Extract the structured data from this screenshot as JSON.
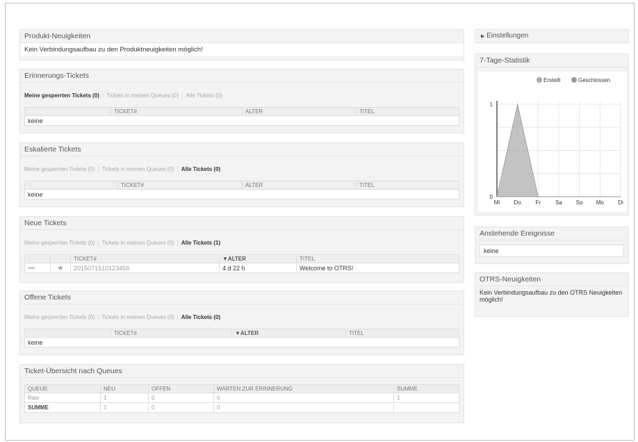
{
  "produkt_neuigkeiten": {
    "title": "Produkt-Neuigkeiten",
    "message": "Kein Verbindungsaufbau zu den Produktneuigkeiten möglich!"
  },
  "filters": {
    "locked": "Meine gesperrten Tickets",
    "queues": "Tickets in meinen Queues",
    "all": "Alle Tickets"
  },
  "columns": {
    "ticket": "TICKET#",
    "alter": "ALTER",
    "alter_sorted": "▼ALTER",
    "titel": "TITEL"
  },
  "erinnerung": {
    "title": "Erinnerungs-Tickets",
    "locked_count": "(0)",
    "queues_count": "(0)",
    "all_count": "(0)",
    "empty": "keine"
  },
  "eskaliert": {
    "title": "Eskalierte Tickets",
    "locked_count": "(0)",
    "queues_count": "(0)",
    "all_count": "(0)",
    "empty": "keine"
  },
  "neue": {
    "title": "Neue Tickets",
    "locked_count": "(0)",
    "queues_count": "(0)",
    "all_count": "(1)",
    "row": {
      "number": "2015071510123456",
      "age": "4 d 22 h",
      "title": "Welcome to OTRS!"
    }
  },
  "offene": {
    "title": "Offene Tickets",
    "locked_count": "(0)",
    "queues_count": "(0)",
    "all_count": "(0)",
    "empty": "keine"
  },
  "queues_overview": {
    "title": "Ticket-Übersicht nach Queues",
    "headers": [
      "QUEUE",
      "NEU",
      "OFFEN",
      "WARTEN ZUR ERINNERUNG",
      "SUMME"
    ],
    "rows": [
      [
        "Raw",
        "1",
        "0",
        "0",
        "1"
      ],
      [
        "SUMME",
        "1",
        "0",
        "0",
        ""
      ]
    ]
  },
  "sidebar": {
    "settings": "Einstellungen",
    "stats_title": "7-Tage-Statistik",
    "legend": [
      "Erstellt",
      "Geschlossen"
    ],
    "pending_title": "Anstehende Ereignisse",
    "pending_value": "keine",
    "otrs_title": "OTRS-Neuigkeiten",
    "otrs_message": "Kein Verbindungsaufbau zu den OTRS Neuigkeiten möglich!"
  },
  "chart_data": {
    "type": "area",
    "categories": [
      "Mi",
      "Do",
      "Fr",
      "Sa",
      "So",
      "Mo",
      "Di"
    ],
    "series": [
      {
        "name": "Erstellt",
        "values": [
          0,
          1,
          0,
          0,
          0,
          0,
          0
        ]
      },
      {
        "name": "Geschlossen",
        "values": [
          0,
          0,
          0,
          0,
          0,
          0,
          0
        ]
      }
    ],
    "ylim": [
      0,
      1
    ],
    "yticks": [
      "0",
      "1"
    ],
    "grid": true,
    "legend": "top-right",
    "colors": [
      "#aaaaaa",
      "#999999"
    ]
  }
}
